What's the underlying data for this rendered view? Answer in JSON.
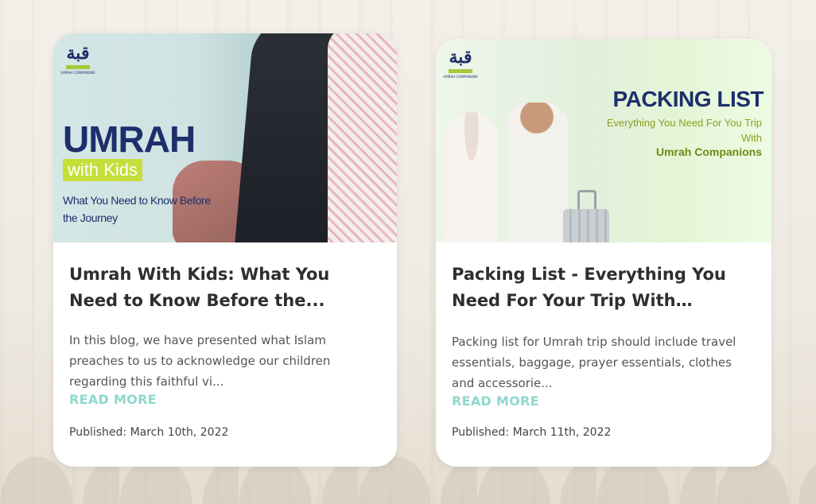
{
  "cards": [
    {
      "hero": {
        "logo_glyph": "قبة",
        "logo_caption": "UMRAH COMPANIONS",
        "headline": "UMRAH",
        "highlight": "with Kids",
        "subline": "What You Need to Know Before the Journey"
      },
      "title": "Umrah With Kids: What You Need to Know Before the...",
      "excerpt": "In this blog, we have presented what Islam preaches to us to acknowledge our children regarding this faithful vi...",
      "read_more": "READ MORE",
      "published": "Published: March 10th, 2022"
    },
    {
      "hero": {
        "logo_glyph": "قبة",
        "logo_caption": "UMRAH COMPANIONS",
        "headline": "PACKING LIST",
        "subline": "Everything You Need For You Trip With",
        "brand": "Umrah Companions"
      },
      "title": "Packing List - Everything You Need For Your Trip With Umrah...",
      "excerpt": "Packing list for Umrah trip should include travel essentials, baggage, prayer essentials, clothes and accessorie...",
      "read_more": "READ MORE",
      "published": "Published: March 11th, 2022"
    }
  ],
  "colors": {
    "accent": "#8ed8cb",
    "navy": "#1d2f6b",
    "lime": "#c6de3a"
  }
}
